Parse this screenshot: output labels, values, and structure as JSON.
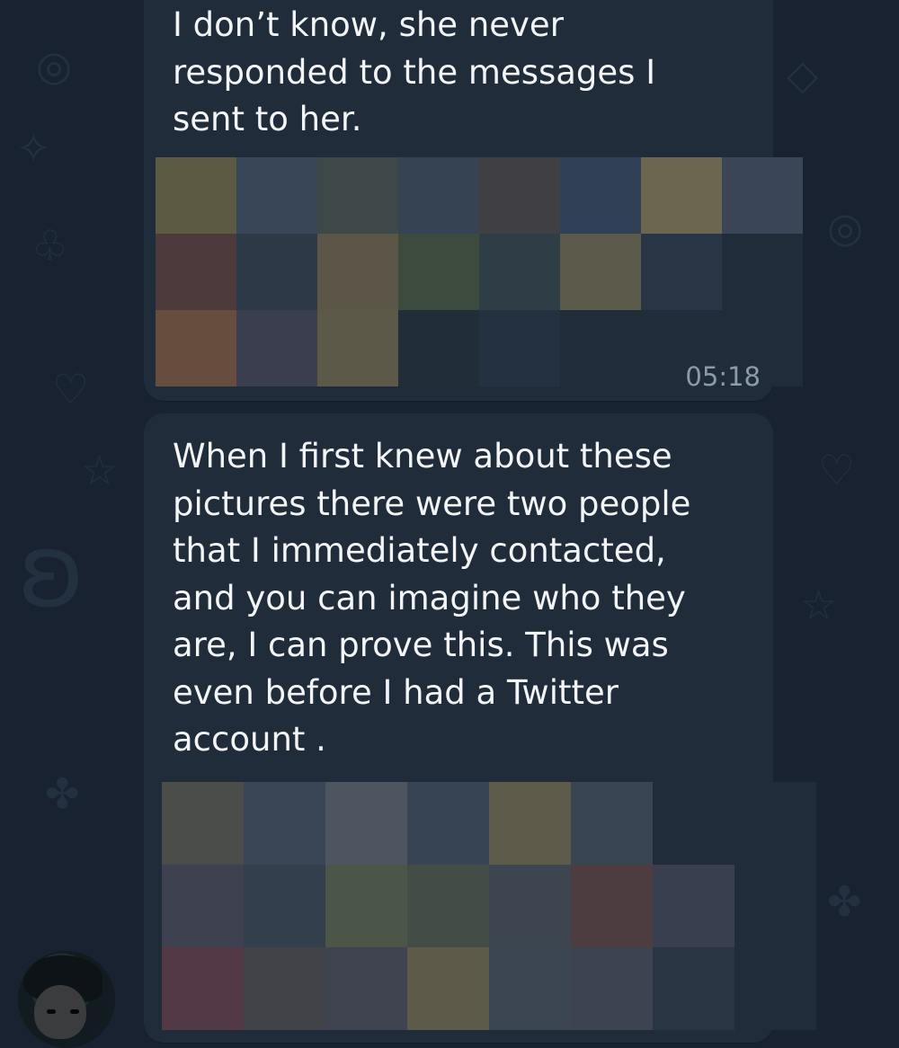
{
  "conversation": {
    "messages": [
      {
        "text": "I don’t know, she never\nresponded to the messages I\nsent to her.",
        "time": "05:18"
      },
      {
        "text": "When I first knew about these\npictures there were two people\nthat I immediately contacted,\nand you can imagine who they\nare, I can prove this. This was\neven before I had a Twitter\naccount ."
      }
    ]
  },
  "theme": {
    "background": "#182230",
    "bubble": "#202c3a",
    "text": "#f2f4f6",
    "time": "#8d9aa9"
  },
  "icons": {
    "wallpaper": [
      "star-icon",
      "heart-icon",
      "swirl-icon",
      "dinosaur-icon",
      "pizza-icon",
      "paw-icon",
      "cupcake-icon"
    ],
    "avatar": "avatar"
  }
}
